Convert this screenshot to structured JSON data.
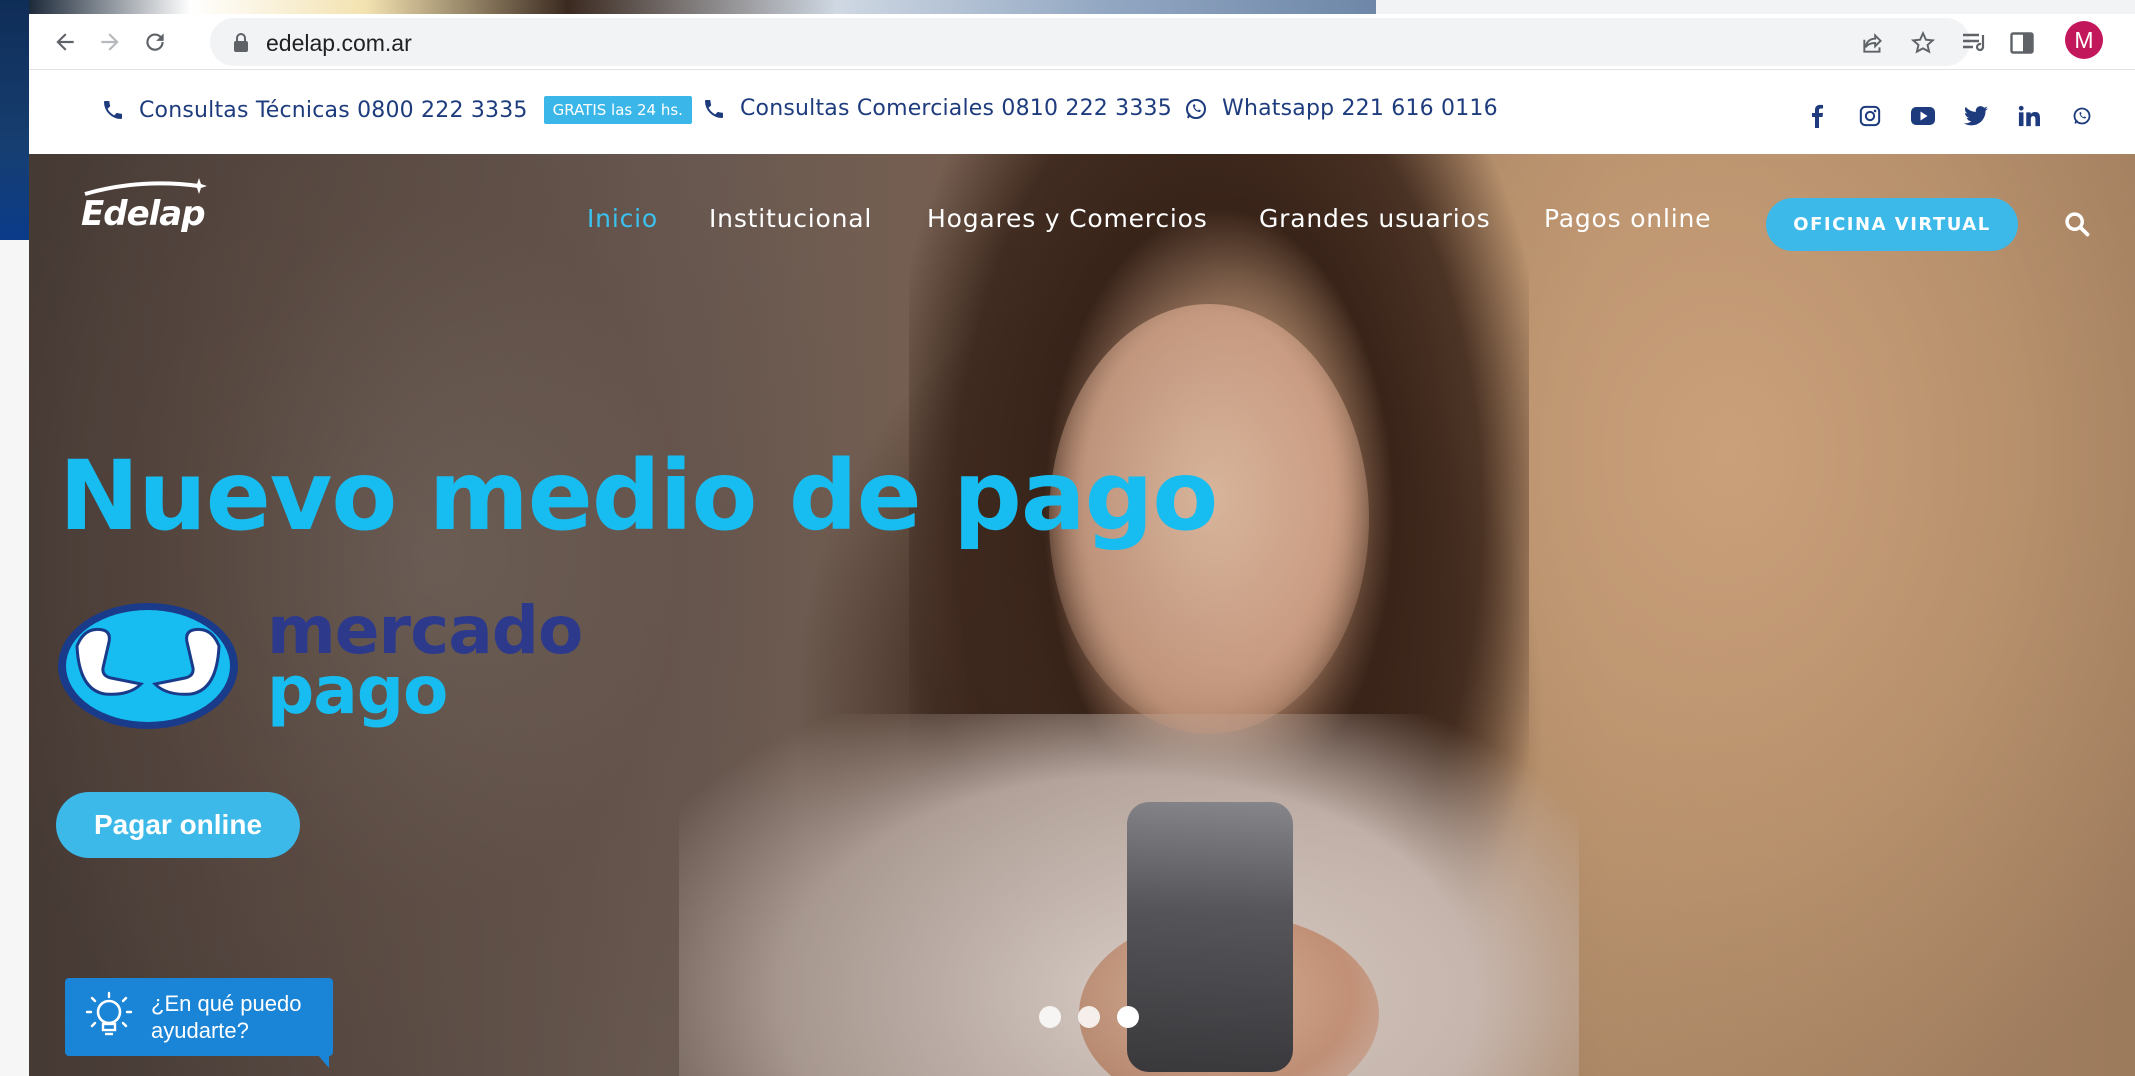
{
  "browser": {
    "url": "edelap.com.ar",
    "profile_initial": "M"
  },
  "utility_bar": {
    "tech": {
      "label": "Consultas Técnicas 0800 222 3335",
      "badge": "GRATIS las 24 hs."
    },
    "commercial": {
      "label": "Consultas Comerciales 0810 222 3335"
    },
    "whatsapp": {
      "label": "Whatsapp 221 616 0116"
    },
    "social_icons": [
      "facebook-icon",
      "instagram-icon",
      "youtube-icon",
      "twitter-icon",
      "linkedin-icon",
      "whatsapp-icon"
    ]
  },
  "header": {
    "logo_text": "Edelap",
    "nav": [
      "Inicio",
      "Institucional",
      "Hogares y Comercios",
      "Grandes usuarios",
      "Pagos online"
    ],
    "active_nav": "Inicio",
    "cta": "OFICINA VIRTUAL"
  },
  "hero": {
    "title": "Nuevo medio de pago",
    "brand_line1": "mercado",
    "brand_line2": "pago",
    "button": "Pagar online",
    "slides_total": 3,
    "active_slide": 3
  },
  "help_widget": {
    "text": "¿En qué puedo ayudarte?"
  },
  "colors": {
    "accent": "#3cb9e9",
    "title": "#17bdf0",
    "brand_navy": "#1e3c7d",
    "mp_navy": "#2d3a8c",
    "widget": "#1a84d6"
  }
}
